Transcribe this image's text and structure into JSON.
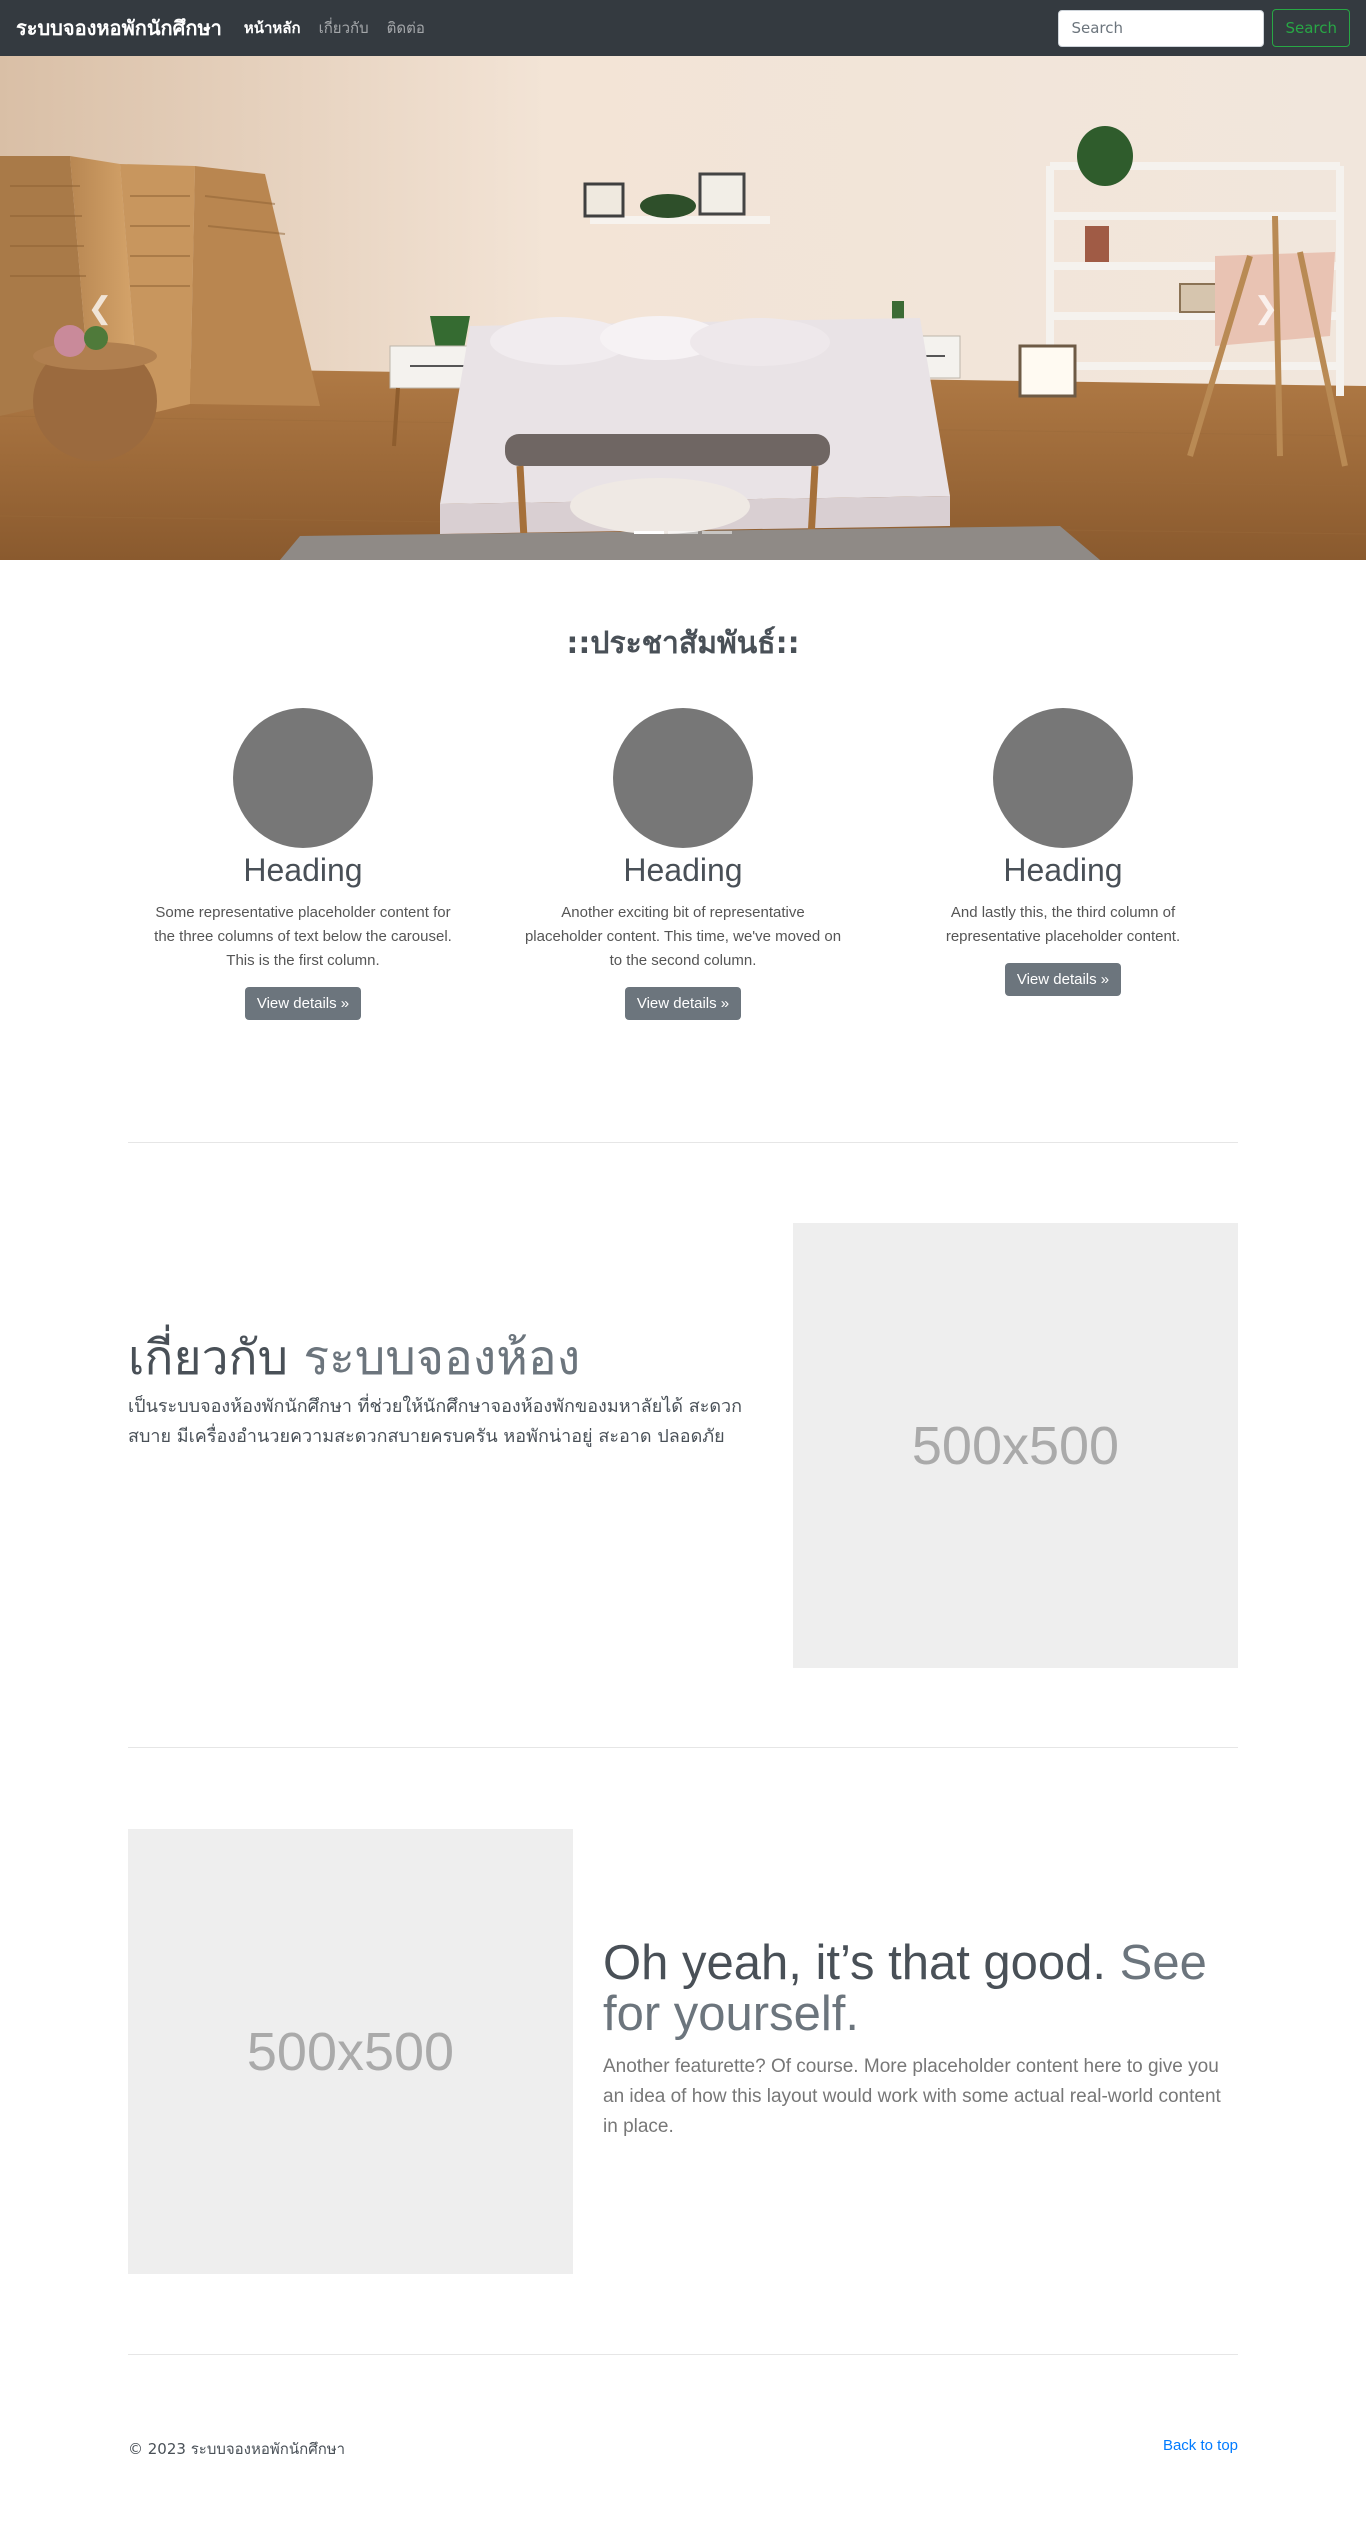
{
  "navbar": {
    "brand": "ระบบจองหอพักนักศึกษา",
    "links": [
      "หน้าหลัก",
      "เกี่ยวกับ",
      "ติดต่อ"
    ],
    "search_placeholder": "Search",
    "search_button": "Search"
  },
  "carousel": {
    "prev_icon": "chevron-left-icon",
    "next_icon": "chevron-right-icon",
    "slide_count": 3,
    "active_slide": 1
  },
  "pr_heading": "::ประชาสัมพันธ์::",
  "columns": [
    {
      "heading": "Heading",
      "text": "Some representative placeholder content for the three columns of text below the carousel. This is the first column.",
      "button": "View details »"
    },
    {
      "heading": "Heading",
      "text": "Another exciting bit of representative placeholder content. This time, we've moved on to the second column.",
      "button": "View details »"
    },
    {
      "heading": "Heading",
      "text": "And lastly this, the third column of representative placeholder content.",
      "button": "View details »"
    }
  ],
  "featurette1": {
    "heading": "เกี่ยวกับ",
    "heading_muted": "ระบบจองห้อง",
    "lead": "เป็นระบบจองห้องพักนักศึกษา ที่ช่วยให้นักศึกษาจองห้องพักของมหาลัยได้ สะดวกสบาย มีเครื่องอำนวยความสะดวกสบายครบครัน หอพักน่าอยู่ สะอาด ปลอดภัย",
    "image_label": "500x500"
  },
  "featurette2": {
    "heading": "Oh yeah, it’s that good.",
    "heading_muted": "See for yourself.",
    "lead": "Another featurette? Of course. More placeholder content here to give you an idea of how this layout would work with some actual real-world content in place.",
    "image_label": "500x500"
  },
  "footer": {
    "copyright": "© 2023 ระบบจองหอพักนักศึกษา",
    "back_to_top": "Back to top"
  },
  "colors": {
    "navbar_bg": "#343a40",
    "search_button": "#28a745",
    "secondary_button": "#6c757d",
    "link": "#007bff",
    "placeholder_bg": "#eeeeee"
  }
}
